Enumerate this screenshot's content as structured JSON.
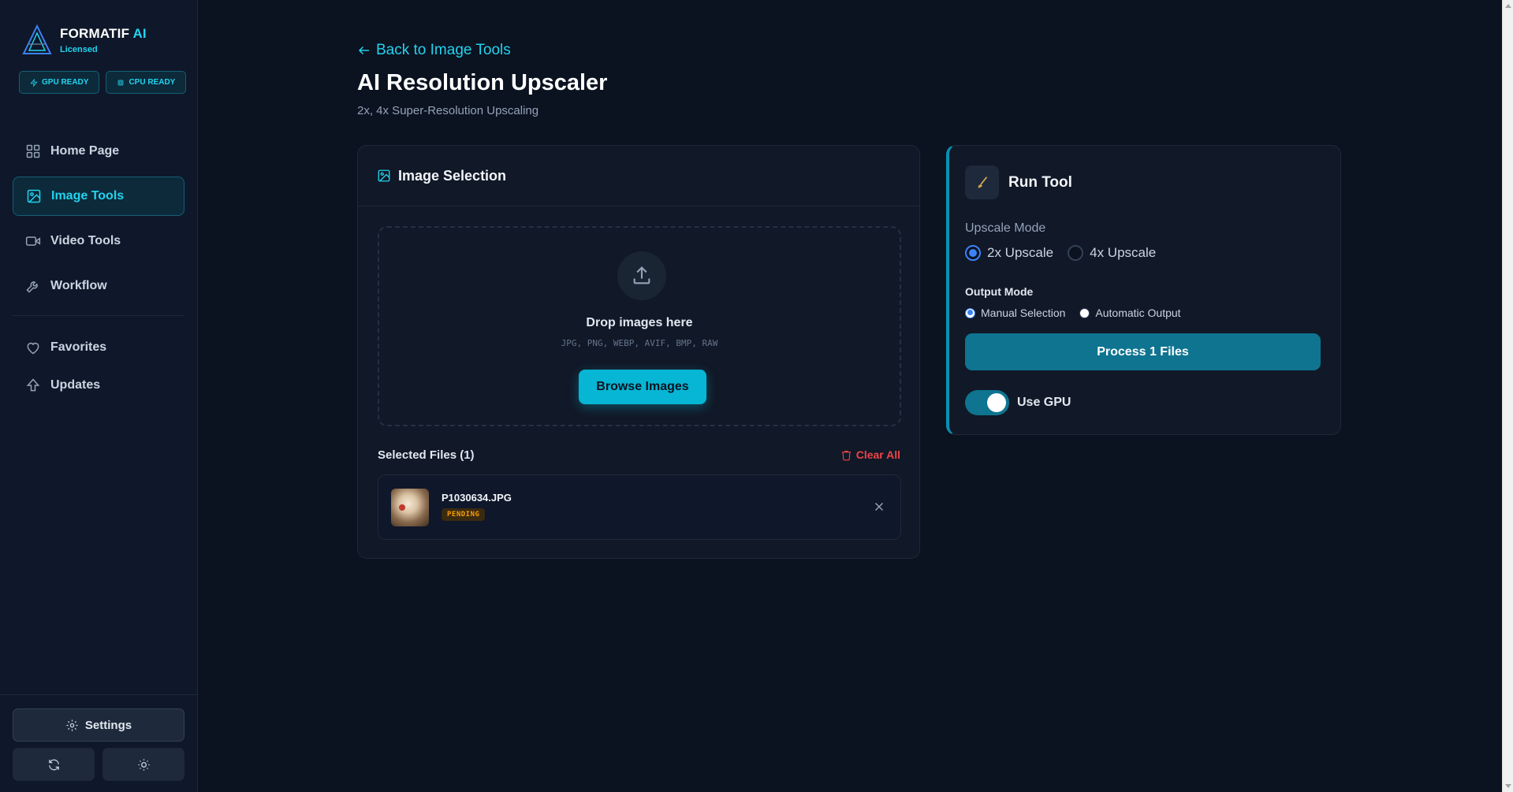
{
  "brand": {
    "name": "FORMATIF",
    "name_accent": "AI",
    "license": "Licensed"
  },
  "badges": [
    {
      "label": "GPU READY",
      "icon": "bolt-icon"
    },
    {
      "label": "CPU READY",
      "icon": "chip-icon"
    }
  ],
  "nav": [
    {
      "label": "Home Page",
      "icon": "grid-icon",
      "active": false
    },
    {
      "label": "Image Tools",
      "icon": "image-icon",
      "active": true
    },
    {
      "label": "Video Tools",
      "icon": "video-icon",
      "active": false
    },
    {
      "label": "Workflow",
      "icon": "wrench-icon",
      "active": false
    }
  ],
  "nav_secondary": [
    {
      "label": "Favorites",
      "icon": "heart-icon"
    },
    {
      "label": "Updates",
      "icon": "arrow-up-icon"
    }
  ],
  "sidebar_footer": {
    "settings_label": "Settings",
    "refresh_icon": "refresh-icon",
    "theme_icon": "sun-icon"
  },
  "header": {
    "back_label": "Back to Image Tools",
    "title": "AI Resolution Upscaler",
    "subtitle": "2x, 4x Super-Resolution Upscaling"
  },
  "image_selection": {
    "title": "Image Selection",
    "drop_title": "Drop images here",
    "formats": "JPG, PNG, WEBP, AVIF, BMP, RAW",
    "browse_label": "Browse Images",
    "files_heading": "Selected Files (1)",
    "clear_label": "Clear All",
    "files": [
      {
        "name": "P1030634.JPG",
        "status": "PENDING"
      }
    ]
  },
  "run_tool": {
    "title": "Run Tool",
    "upscale_label": "Upscale Mode",
    "upscale_options": [
      {
        "label": "2x Upscale",
        "selected": true
      },
      {
        "label": "4x Upscale",
        "selected": false
      }
    ],
    "output_label": "Output Mode",
    "output_options": [
      {
        "label": "Manual Selection",
        "selected": true
      },
      {
        "label": "Automatic Output",
        "selected": false
      }
    ],
    "process_label": "Process 1 Files",
    "gpu_label": "Use GPU",
    "gpu_enabled": true
  },
  "colors": {
    "accent": "#22d3ee",
    "background": "#0b1220",
    "danger": "#ef4444",
    "pending": "#f59e0b"
  }
}
